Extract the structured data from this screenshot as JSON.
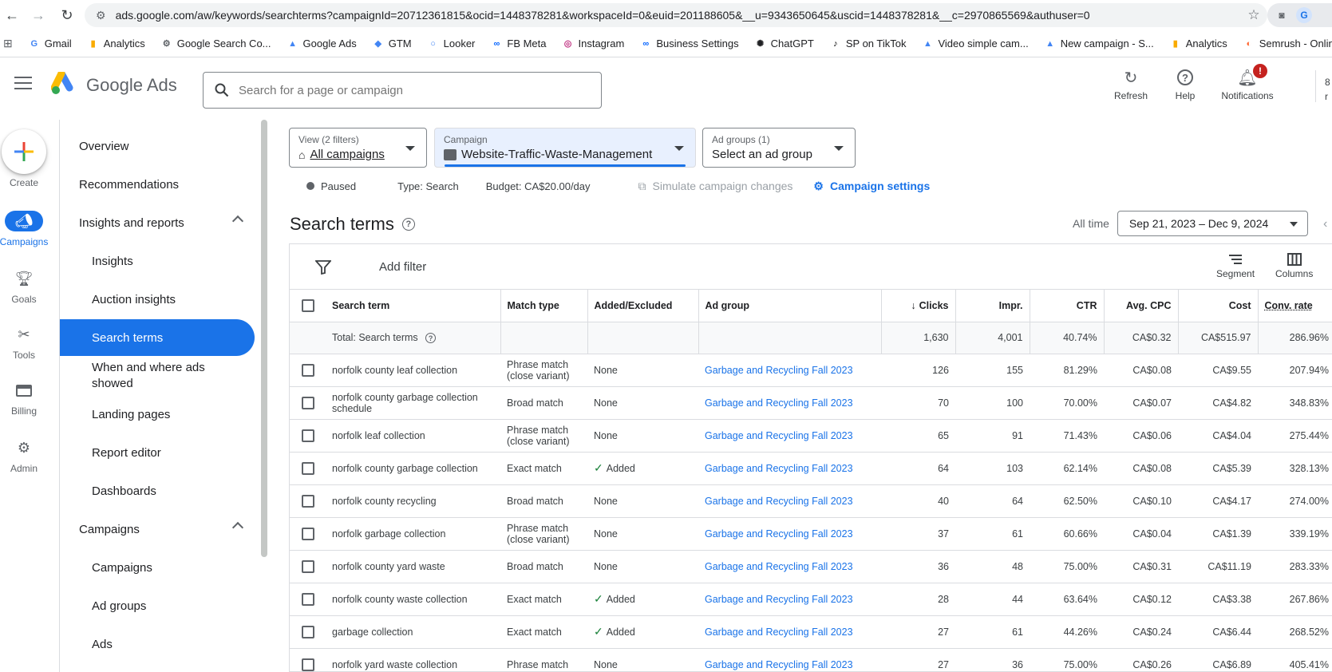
{
  "browser": {
    "url": "ads.google.com/aw/keywords/searchterms?campaignId=20712361815&ocid=1448378281&workspaceId=0&euid=201188605&__u=9343650645&uscid=1448378281&__c=2970865569&authuser=0",
    "bookmarks": [
      "Gmail",
      "Analytics",
      "Google Search Co...",
      "Google Ads",
      "GTM",
      "Looker",
      "FB Meta",
      "Instagram",
      "Business Settings",
      "ChatGPT",
      "SP on TikTok",
      "Video simple cam...",
      "New campaign - S...",
      "Analytics",
      "Semrush - Online..."
    ]
  },
  "header": {
    "product": "Google Ads",
    "search_placeholder": "Search for a page or campaign",
    "refresh": "Refresh",
    "help": "Help",
    "notifications": "Notifications",
    "notif_badge": "!",
    "partial_text_1": "8",
    "partial_text_2": "r"
  },
  "rail": {
    "create": "Create",
    "items": [
      "Campaigns",
      "Goals",
      "Tools",
      "Billing",
      "Admin"
    ]
  },
  "nav": {
    "items": [
      "Overview",
      "Recommendations",
      "Insights and reports",
      "Insights",
      "Auction insights",
      "Search terms",
      "When and where ads showed",
      "Landing pages",
      "Report editor",
      "Dashboards",
      "Campaigns",
      "Campaigns",
      "Ad groups",
      "Ads"
    ]
  },
  "filters": {
    "view_caption": "View (2 filters)",
    "view_value": "All campaigns",
    "campaign_caption": "Campaign",
    "campaign_value": "Website-Traffic-Waste-Management",
    "adgroups_caption": "Ad groups (1)",
    "adgroups_value": "Select an ad group"
  },
  "status": {
    "state": "Paused",
    "type": "Type: Search",
    "budget": "Budget: CA$20.00/day",
    "simulate": "Simulate campaign changes",
    "settings": "Campaign settings"
  },
  "page": {
    "title": "Search terms",
    "all_time": "All time",
    "date_range": "Sep 21, 2023 – Dec 9, 2024"
  },
  "toolbar": {
    "add_filter": "Add filter",
    "segment": "Segment",
    "columns": "Columns"
  },
  "table": {
    "headers": [
      "Search term",
      "Match type",
      "Added/Excluded",
      "Ad group",
      "Clicks",
      "Impr.",
      "CTR",
      "Avg. CPC",
      "Cost",
      "Conv. rate"
    ],
    "total": {
      "label": "Total: Search terms",
      "clicks": "1,630",
      "impr": "4,001",
      "ctr": "40.74%",
      "cpc": "CA$0.32",
      "cost": "CA$515.97",
      "conv": "286.96%"
    },
    "rows": [
      {
        "term": "norfolk county leaf collection",
        "match": "Phrase match (close variant)",
        "added": "None",
        "group": "Garbage and Recycling Fall 2023",
        "clicks": "126",
        "impr": "155",
        "ctr": "81.29%",
        "cpc": "CA$0.08",
        "cost": "CA$9.55",
        "conv": "207.94%"
      },
      {
        "term": "norfolk county garbage collection schedule",
        "match": "Broad match",
        "added": "None",
        "group": "Garbage and Recycling Fall 2023",
        "clicks": "70",
        "impr": "100",
        "ctr": "70.00%",
        "cpc": "CA$0.07",
        "cost": "CA$4.82",
        "conv": "348.83%"
      },
      {
        "term": "norfolk leaf collection",
        "match": "Phrase match (close variant)",
        "added": "None",
        "group": "Garbage and Recycling Fall 2023",
        "clicks": "65",
        "impr": "91",
        "ctr": "71.43%",
        "cpc": "CA$0.06",
        "cost": "CA$4.04",
        "conv": "275.44%"
      },
      {
        "term": "norfolk county garbage collection",
        "match": "Exact match",
        "added": "Added",
        "group": "Garbage and Recycling Fall 2023",
        "clicks": "64",
        "impr": "103",
        "ctr": "62.14%",
        "cpc": "CA$0.08",
        "cost": "CA$5.39",
        "conv": "328.13%"
      },
      {
        "term": "norfolk county recycling",
        "match": "Broad match",
        "added": "None",
        "group": "Garbage and Recycling Fall 2023",
        "clicks": "40",
        "impr": "64",
        "ctr": "62.50%",
        "cpc": "CA$0.10",
        "cost": "CA$4.17",
        "conv": "274.00%"
      },
      {
        "term": "norfolk garbage collection",
        "match": "Phrase match (close variant)",
        "added": "None",
        "group": "Garbage and Recycling Fall 2023",
        "clicks": "37",
        "impr": "61",
        "ctr": "60.66%",
        "cpc": "CA$0.04",
        "cost": "CA$1.39",
        "conv": "339.19%"
      },
      {
        "term": "norfolk county yard waste",
        "match": "Broad match",
        "added": "None",
        "group": "Garbage and Recycling Fall 2023",
        "clicks": "36",
        "impr": "48",
        "ctr": "75.00%",
        "cpc": "CA$0.31",
        "cost": "CA$11.19",
        "conv": "283.33%"
      },
      {
        "term": "norfolk county waste collection",
        "match": "Exact match",
        "added": "Added",
        "group": "Garbage and Recycling Fall 2023",
        "clicks": "28",
        "impr": "44",
        "ctr": "63.64%",
        "cpc": "CA$0.12",
        "cost": "CA$3.38",
        "conv": "267.86%"
      },
      {
        "term": "garbage collection",
        "match": "Exact match",
        "added": "Added",
        "group": "Garbage and Recycling Fall 2023",
        "clicks": "27",
        "impr": "61",
        "ctr": "44.26%",
        "cpc": "CA$0.24",
        "cost": "CA$6.44",
        "conv": "268.52%"
      },
      {
        "term": "norfolk yard waste collection",
        "match": "Phrase match",
        "added": "None",
        "group": "Garbage and Recycling Fall 2023",
        "clicks": "27",
        "impr": "36",
        "ctr": "75.00%",
        "cpc": "CA$0.26",
        "cost": "CA$6.89",
        "conv": "405.41%"
      }
    ]
  },
  "colors": {
    "accent": "#1a73e8",
    "added_check": "#188038",
    "badge": "#c5221f"
  }
}
